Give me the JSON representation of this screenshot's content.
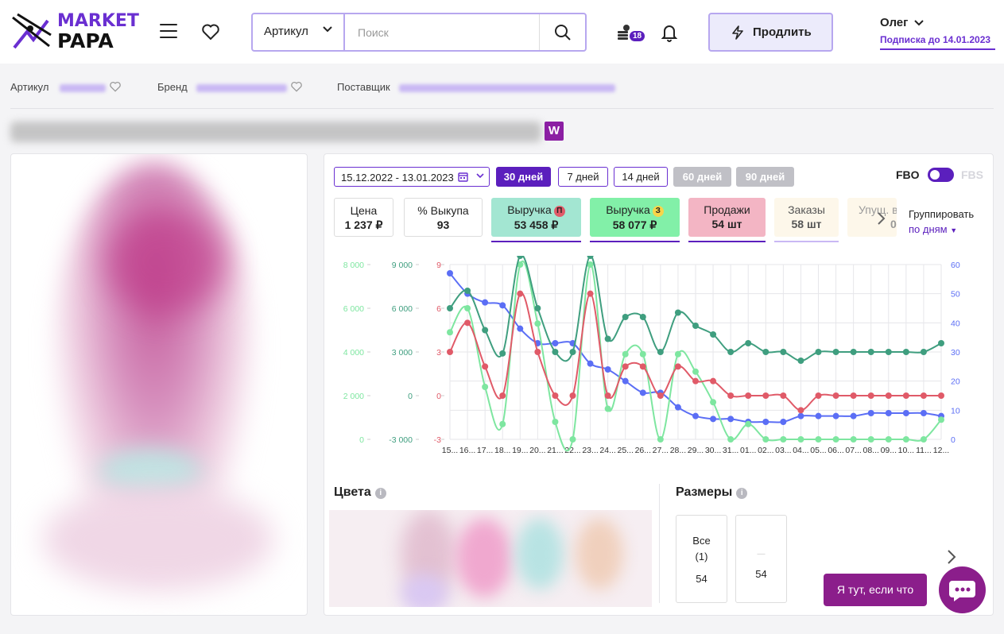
{
  "logo": {
    "line1": "MARKET",
    "line2": "PAPA"
  },
  "search": {
    "select_value": "Артикул",
    "placeholder": "Поиск"
  },
  "header": {
    "notifications_badge": "18",
    "extend_label": "Продлить"
  },
  "user": {
    "name": "Олег",
    "subscription": "Подписка до 14.01.2023"
  },
  "meta": {
    "article_label": "Артикул",
    "brand_label": "Бренд",
    "supplier_label": "Поставщик"
  },
  "product": {
    "marketplace_badge": "W"
  },
  "filters": {
    "date_range": "15.12.2022 - 13.01.2023",
    "periods": [
      "30 дней",
      "7 дней",
      "14 дней",
      "60 дней",
      "90 дней"
    ],
    "fbo": "FBO",
    "fbs": "FBS"
  },
  "metrics": [
    {
      "label": "Цена",
      "value": "1 237 ₽",
      "marker": ""
    },
    {
      "label": "% Выкупа",
      "value": "93",
      "marker": ""
    },
    {
      "label": "Выручка",
      "value": "53 458 ₽",
      "marker": "П"
    },
    {
      "label": "Выручка",
      "value": "58 077 ₽",
      "marker": "З"
    },
    {
      "label": "Продажи",
      "value": "54 шт",
      "marker": ""
    },
    {
      "label": "Заказы",
      "value": "58 шт",
      "marker": ""
    },
    {
      "label": "Упущ. в",
      "value": "0",
      "marker": ""
    }
  ],
  "grouping": {
    "label": "Группировать",
    "value": "по дням"
  },
  "colors": {
    "accent": "#5b1fbd",
    "brand": "#8b1e8b",
    "revenue_p": "#a3e6d2",
    "revenue_z": "#82f0a8",
    "sales": "#f3b5c4"
  },
  "sections": {
    "colors_title": "Цвета",
    "sizes_title": "Размеры"
  },
  "sizes": [
    {
      "name": "Все",
      "count": "(1)",
      "value": "54"
    },
    {
      "name": "—",
      "count": "",
      "value": "54"
    }
  ],
  "help": {
    "label": "Я тут, если что"
  },
  "chart_data": {
    "type": "line",
    "categories": [
      "15...",
      "16...",
      "17...",
      "18...",
      "19...",
      "20...",
      "21...",
      "22...",
      "23...",
      "24...",
      "25...",
      "26...",
      "27...",
      "28...",
      "29...",
      "30...",
      "31...",
      "01...",
      "02...",
      "03...",
      "04...",
      "05...",
      "06...",
      "07...",
      "08...",
      "09...",
      "10...",
      "11...",
      "12..."
    ],
    "axes": {
      "left1": {
        "ticks": [
          "8 000",
          "6 000",
          "4 000",
          "2 000",
          "0"
        ],
        "color": "#7ee6a0"
      },
      "left2": {
        "ticks": [
          "9 000",
          "6 000",
          "3 000",
          "0",
          "-3 000"
        ],
        "color": "#3f9e7f"
      },
      "left3": {
        "ticks": [
          "9",
          "6",
          "3",
          "0",
          "-3"
        ],
        "color": "#e05a68"
      },
      "right": {
        "ticks": [
          "60",
          "50",
          "40",
          "30",
          "20",
          "10",
          "0"
        ],
        "color": "#5b6ef5"
      }
    },
    "series": [
      {
        "axis": "right",
        "color": "#5b6ef5",
        "values": [
          57,
          50,
          47,
          46,
          38,
          33,
          33,
          33,
          26,
          24,
          20,
          16,
          16,
          11,
          8,
          7,
          7,
          6,
          6,
          6,
          8,
          8,
          8,
          8,
          9,
          9,
          9,
          9,
          8
        ]
      },
      {
        "axis": "left1",
        "color": "#7ee6a0",
        "values": [
          4900,
          6000,
          2400,
          700,
          8000,
          5300,
          800,
          0,
          8000,
          1400,
          3900,
          3900,
          0,
          3900,
          3100,
          1700,
          0,
          700,
          0,
          0,
          0,
          0,
          0,
          0,
          0,
          0,
          0,
          0,
          900
        ]
      },
      {
        "axis": "left2",
        "color": "#3f9e7f",
        "values": [
          6000,
          7200,
          4500,
          2900,
          9600,
          6000,
          3000,
          3000,
          9600,
          3900,
          5400,
          5400,
          3000,
          5700,
          4800,
          4200,
          3000,
          3600,
          3000,
          3000,
          2400,
          3000,
          3000,
          3000,
          3000,
          3000,
          3000,
          3000,
          3600
        ]
      },
      {
        "axis": "left3",
        "color": "#e05a68",
        "values": [
          3,
          5,
          2,
          0,
          7,
          3,
          0,
          0,
          7,
          0,
          2,
          2,
          0,
          2,
          1,
          1,
          0,
          0,
          0,
          0,
          -1,
          0,
          0,
          0,
          0,
          0,
          0,
          0,
          0
        ]
      }
    ]
  }
}
